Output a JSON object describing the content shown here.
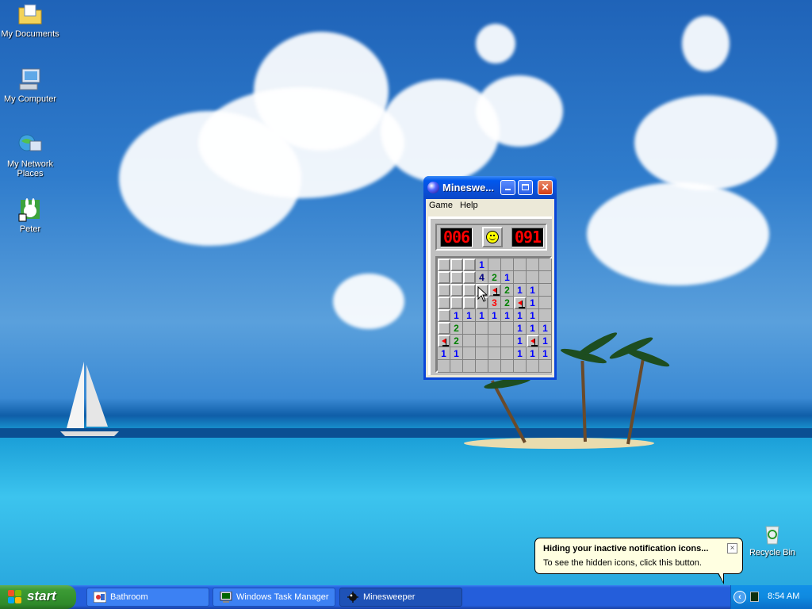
{
  "desktop": {
    "icons": [
      {
        "label": "My Documents",
        "icon": "folder-documents-icon"
      },
      {
        "label": "My Computer",
        "icon": "computer-icon"
      },
      {
        "label": "My Network Places",
        "icon": "network-icon"
      },
      {
        "label": "Peter",
        "icon": "user-shortcut-icon"
      },
      {
        "label": "Recycle Bin",
        "icon": "recycle-bin-icon"
      }
    ]
  },
  "minesweeper": {
    "title": "Mineswe...",
    "menu": [
      "Game",
      "Help"
    ],
    "mine_counter": "006",
    "timer": "091",
    "board": [
      [
        "#",
        "#",
        "#",
        "1",
        ".",
        ".",
        ".",
        ".",
        " "
      ],
      [
        "#",
        "#",
        "#",
        "4",
        "2",
        "1",
        ".",
        ".",
        "."
      ],
      [
        "#",
        "#",
        "#",
        "#",
        "F",
        "2",
        "1",
        "1",
        "."
      ],
      [
        "#",
        "#",
        "#",
        "#",
        "3",
        "2",
        "F",
        "1",
        "."
      ],
      [
        "#",
        "1",
        "1",
        "1",
        "1",
        "1",
        "1",
        "1",
        "."
      ],
      [
        "#",
        "2",
        ".",
        ".",
        ".",
        ".",
        "1",
        "1",
        "1"
      ],
      [
        "F",
        "2",
        ".",
        ".",
        ".",
        ".",
        "1",
        "F",
        "1"
      ],
      [
        "1",
        "1",
        ".",
        ".",
        ".",
        ".",
        "1",
        "1",
        "1"
      ],
      [
        ".",
        ".",
        ".",
        ".",
        ".",
        ".",
        ".",
        ".",
        "."
      ]
    ]
  },
  "taskbar": {
    "start_label": "start",
    "tasks": [
      {
        "label": "Bathroom",
        "icon": "paint-icon",
        "active": false
      },
      {
        "label": "Windows Task Manager",
        "icon": "task-manager-icon",
        "active": false
      },
      {
        "label": "Minesweeper",
        "icon": "minesweeper-icon",
        "active": true
      }
    ],
    "clock": "8:54 AM"
  },
  "balloon": {
    "title": "Hiding your inactive notification icons...",
    "text": "To see the hidden icons, click this button.",
    "close": "×"
  },
  "colors": {
    "taskbar": "#245edb",
    "start": "#3c9b35",
    "title_bar": "#0a4fd8",
    "balloon": "#ffffe1"
  }
}
